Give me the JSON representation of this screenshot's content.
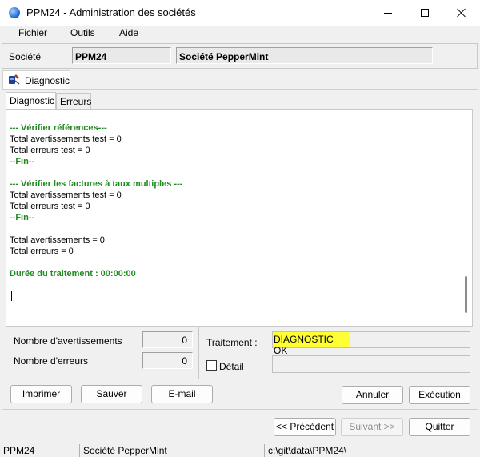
{
  "window": {
    "title": "PPM24 - Administration des sociétés"
  },
  "menu": {
    "items": [
      "Fichier",
      "Outils",
      "Aide"
    ]
  },
  "company": {
    "label": "Société",
    "code": "PPM24",
    "name": "Société PepperMint"
  },
  "outer_tab": {
    "label": "Diagnostic"
  },
  "inner_tabs": {
    "active": "Diagnostic",
    "other": "Erreurs"
  },
  "log": {
    "lines": [
      {
        "text": "--- Vérifier références---",
        "style": "green"
      },
      {
        "text": "Total avertissements test = 0",
        "style": "normal"
      },
      {
        "text": "Total erreurs test = 0",
        "style": "normal"
      },
      {
        "text": "--Fin--",
        "style": "green"
      },
      {
        "text": "",
        "style": "normal"
      },
      {
        "text": "--- Vérifier les factures à taux multiples ---",
        "style": "green"
      },
      {
        "text": "Total avertissements test = 0",
        "style": "normal"
      },
      {
        "text": "Total erreurs test = 0",
        "style": "normal"
      },
      {
        "text": "--Fin--",
        "style": "green"
      },
      {
        "text": "",
        "style": "normal"
      },
      {
        "text": "Total avertissements = 0",
        "style": "normal"
      },
      {
        "text": "Total erreurs = 0",
        "style": "normal"
      },
      {
        "text": "",
        "style": "normal"
      },
      {
        "text": "Durée du traitement : 00:00:00",
        "style": "green"
      }
    ]
  },
  "stats": {
    "warnings_label": "Nombre d'avertissements",
    "warnings_value": "0",
    "errors_label": "Nombre d'erreurs",
    "errors_value": "0",
    "traitement_label": "Traitement :",
    "traitement_value": "DIAGNOSTIC OK",
    "traitement_color": "#ffff33",
    "detail_label": "Détail",
    "detail_checked": false
  },
  "buttons": {
    "imprimer": "Imprimer",
    "sauver": "Sauver",
    "email": "E-mail",
    "annuler": "Annuler",
    "execution": "Exécution",
    "precedent": "<< Précédent",
    "suivant": "Suivant >>",
    "quitter": "Quitter"
  },
  "statusbar": {
    "code": "PPM24",
    "company": "Société PepperMint",
    "path": "c:\\git\\data\\PPM24\\"
  },
  "icons": {
    "app": "app-globe-icon",
    "diagnostic": "diagnostic-icon"
  }
}
